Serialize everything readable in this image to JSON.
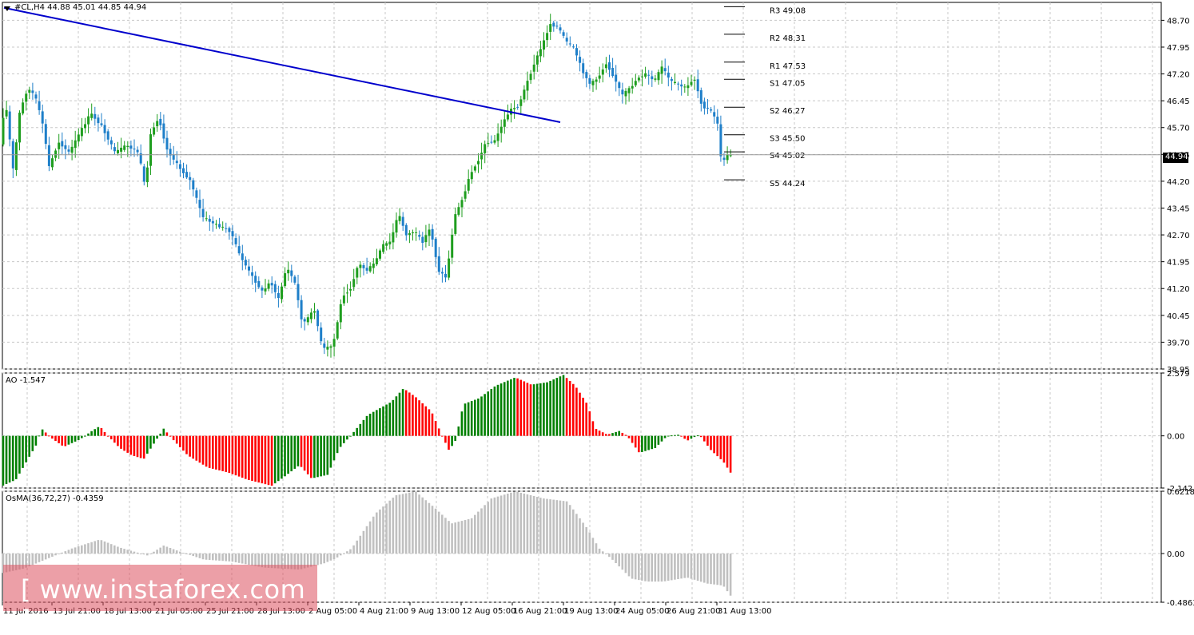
{
  "window": {
    "header": "#CL,H4  44.88 45.01 44.85 44.94",
    "price_label": "44.94",
    "watermark": "[ www.instaforex.com ]"
  },
  "colors": {
    "bull": "#1f9e1f",
    "bear": "#1e7fc9",
    "trend": "#0000cc",
    "ao_up": "#008000",
    "ao_down": "#ff0000",
    "osma": "#c0c0c0",
    "grid": "#c8c8c8",
    "watermark": "#dc505f"
  },
  "chart_data": [
    {
      "type": "candlestick",
      "symbol": "#CL,H4",
      "ylim": [
        38.95,
        49.2
      ],
      "y_ticks": [
        "48.70",
        "47.95",
        "47.20",
        "46.45",
        "45.70",
        "44.95",
        "44.20",
        "43.45",
        "42.70",
        "41.95",
        "41.20",
        "40.45",
        "39.70",
        "38.95"
      ],
      "x_ticks": [
        "11 Jul 2016",
        "13 Jul 21:00",
        "18 Jul 13:00",
        "21 Jul 05:00",
        "25 Jul 21:00",
        "28 Jul 13:00",
        "2 Aug 05:00",
        "4 Aug 21:00",
        "9 Aug 13:00",
        "12 Aug 05:00",
        "16 Aug 21:00",
        "19 Aug 13:00",
        "24 Aug 05:00",
        "26 Aug 21:00",
        "31 Aug 13:00"
      ],
      "path": [
        [
          0,
          44.9
        ],
        [
          8,
          46.5
        ],
        [
          18,
          44.5
        ],
        [
          26,
          46.1
        ],
        [
          36,
          46.8
        ],
        [
          45,
          46.6
        ],
        [
          55,
          45.8
        ],
        [
          63,
          44.6
        ],
        [
          75,
          45.3
        ],
        [
          88,
          45.0
        ],
        [
          100,
          45.5
        ],
        [
          115,
          46.1
        ],
        [
          130,
          45.7
        ],
        [
          145,
          45.0
        ],
        [
          160,
          45.2
        ],
        [
          175,
          45.0
        ],
        [
          183,
          44.0
        ],
        [
          190,
          45.5
        ],
        [
          200,
          46.0
        ],
        [
          210,
          45.1
        ],
        [
          225,
          44.6
        ],
        [
          240,
          44.2
        ],
        [
          255,
          43.2
        ],
        [
          270,
          43.0
        ],
        [
          290,
          42.8
        ],
        [
          300,
          42.2
        ],
        [
          315,
          41.6
        ],
        [
          330,
          41.1
        ],
        [
          340,
          41.4
        ],
        [
          350,
          40.9
        ],
        [
          360,
          41.8
        ],
        [
          370,
          41.4
        ],
        [
          380,
          40.2
        ],
        [
          395,
          40.6
        ],
        [
          405,
          39.5
        ],
        [
          418,
          39.6
        ],
        [
          430,
          41.0
        ],
        [
          440,
          41.2
        ],
        [
          450,
          41.9
        ],
        [
          460,
          41.7
        ],
        [
          470,
          41.9
        ],
        [
          480,
          42.4
        ],
        [
          490,
          42.5
        ],
        [
          500,
          43.3
        ],
        [
          510,
          42.7
        ],
        [
          520,
          42.8
        ],
        [
          530,
          42.5
        ],
        [
          540,
          42.9
        ],
        [
          550,
          41.7
        ],
        [
          560,
          41.5
        ],
        [
          570,
          43.2
        ],
        [
          580,
          43.7
        ],
        [
          590,
          44.4
        ],
        [
          600,
          44.8
        ],
        [
          610,
          45.3
        ],
        [
          620,
          45.3
        ],
        [
          630,
          45.8
        ],
        [
          640,
          46.2
        ],
        [
          650,
          46.3
        ],
        [
          660,
          46.9
        ],
        [
          670,
          47.5
        ],
        [
          680,
          48.0
        ],
        [
          690,
          48.6
        ],
        [
          700,
          48.5
        ],
        [
          710,
          48.1
        ],
        [
          720,
          47.9
        ],
        [
          730,
          47.3
        ],
        [
          740,
          46.9
        ],
        [
          750,
          47.1
        ],
        [
          760,
          47.5
        ],
        [
          770,
          47.1
        ],
        [
          780,
          46.6
        ],
        [
          790,
          46.8
        ],
        [
          800,
          47.1
        ],
        [
          810,
          47.2
        ],
        [
          820,
          47.0
        ],
        [
          830,
          47.4
        ],
        [
          840,
          47.0
        ],
        [
          850,
          46.9
        ],
        [
          860,
          46.8
        ],
        [
          870,
          47.1
        ],
        [
          880,
          46.3
        ],
        [
          890,
          46.2
        ],
        [
          900,
          45.8
        ],
        [
          904,
          44.7
        ],
        [
          910,
          44.9
        ],
        [
          916,
          44.94
        ]
      ],
      "trend_line": [
        [
          44.9,
          49.05
        ],
        [
          701,
          45.85
        ]
      ],
      "pivot_levels": [
        {
          "label": "R3 49.08",
          "value": 49.08
        },
        {
          "label": "R2 48.31",
          "value": 48.31
        },
        {
          "label": "R1 47.53",
          "value": 47.53
        },
        {
          "label": "S1 47.05",
          "value": 47.05
        },
        {
          "label": "S2 46.27",
          "value": 46.27
        },
        {
          "label": "S3 45.50",
          "value": 45.5
        },
        {
          "label": "S4 45.02",
          "value": 45.02
        },
        {
          "label": "S5 44.24",
          "value": 44.24
        }
      ],
      "last_price": 44.94
    },
    {
      "type": "bar",
      "name": "AO",
      "label": "AO -1.547",
      "ylim": [
        -2.142,
        2.579
      ],
      "y_ticks": [
        "2.579",
        "0.00",
        "-2.142"
      ],
      "path": [
        [
          0,
          -2.1
        ],
        [
          20,
          -1.8
        ],
        [
          45,
          -0.4
        ],
        [
          52,
          0.3
        ],
        [
          65,
          -0.1
        ],
        [
          80,
          -0.45
        ],
        [
          100,
          -0.15
        ],
        [
          115,
          0.2
        ],
        [
          125,
          0.4
        ],
        [
          135,
          0.0
        ],
        [
          150,
          -0.5
        ],
        [
          165,
          -0.8
        ],
        [
          180,
          -0.95
        ],
        [
          195,
          -0.2
        ],
        [
          205,
          0.3
        ],
        [
          215,
          -0.1
        ],
        [
          235,
          -0.8
        ],
        [
          260,
          -1.3
        ],
        [
          285,
          -1.5
        ],
        [
          310,
          -1.8
        ],
        [
          340,
          -2.05
        ],
        [
          355,
          -1.7
        ],
        [
          375,
          -1.2
        ],
        [
          390,
          -1.75
        ],
        [
          410,
          -1.6
        ],
        [
          425,
          -0.5
        ],
        [
          440,
          0.05
        ],
        [
          460,
          0.85
        ],
        [
          490,
          1.4
        ],
        [
          505,
          1.95
        ],
        [
          520,
          1.6
        ],
        [
          540,
          1.0
        ],
        [
          552,
          0.1
        ],
        [
          562,
          -0.6
        ],
        [
          570,
          -0.2
        ],
        [
          580,
          1.3
        ],
        [
          600,
          1.55
        ],
        [
          620,
          2.05
        ],
        [
          645,
          2.4
        ],
        [
          665,
          2.1
        ],
        [
          685,
          2.2
        ],
        [
          705,
          2.5
        ],
        [
          720,
          2.05
        ],
        [
          735,
          1.3
        ],
        [
          745,
          0.3
        ],
        [
          760,
          0.05
        ],
        [
          775,
          0.2
        ],
        [
          785,
          0.0
        ],
        [
          800,
          -0.7
        ],
        [
          820,
          -0.5
        ],
        [
          835,
          0.0
        ],
        [
          850,
          0.05
        ],
        [
          860,
          -0.2
        ],
        [
          875,
          0.05
        ],
        [
          890,
          -0.6
        ],
        [
          905,
          -1.05
        ],
        [
          916,
          -1.6
        ]
      ]
    },
    {
      "type": "bar",
      "name": "OsMA",
      "label": "OsMA(36,72,27) -0.4359",
      "ylim": [
        -0.4863,
        0.6218
      ],
      "y_ticks": [
        "0.6218",
        "0.00",
        "-0.4863"
      ],
      "path": [
        [
          0,
          -0.2
        ],
        [
          30,
          -0.15
        ],
        [
          60,
          -0.05
        ],
        [
          90,
          0.05
        ],
        [
          125,
          0.14
        ],
        [
          150,
          0.06
        ],
        [
          185,
          -0.02
        ],
        [
          205,
          0.08
        ],
        [
          225,
          0.02
        ],
        [
          255,
          -0.06
        ],
        [
          290,
          -0.08
        ],
        [
          330,
          -0.14
        ],
        [
          375,
          -0.16
        ],
        [
          405,
          -0.1
        ],
        [
          420,
          -0.05
        ],
        [
          440,
          0.05
        ],
        [
          470,
          0.4
        ],
        [
          495,
          0.58
        ],
        [
          520,
          0.62
        ],
        [
          545,
          0.45
        ],
        [
          565,
          0.3
        ],
        [
          590,
          0.35
        ],
        [
          615,
          0.55
        ],
        [
          645,
          0.62
        ],
        [
          680,
          0.55
        ],
        [
          710,
          0.52
        ],
        [
          735,
          0.25
        ],
        [
          750,
          0.05
        ],
        [
          765,
          -0.05
        ],
        [
          790,
          -0.25
        ],
        [
          810,
          -0.28
        ],
        [
          830,
          -0.28
        ],
        [
          860,
          -0.24
        ],
        [
          885,
          -0.3
        ],
        [
          905,
          -0.32
        ],
        [
          916,
          -0.44
        ]
      ]
    }
  ]
}
